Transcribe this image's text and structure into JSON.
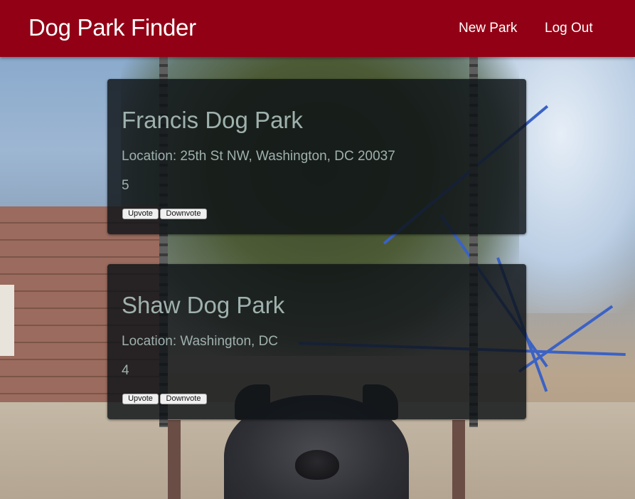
{
  "navbar": {
    "brand": "Dog Park Finder",
    "links": [
      {
        "label": "New Park"
      },
      {
        "label": "Log Out"
      }
    ],
    "color": "#920015"
  },
  "parks": [
    {
      "name": "Francis Dog Park",
      "location": "Location: 25th St NW, Washington, DC 20037",
      "votes": "5",
      "upvote_label": "Upvote",
      "downvote_label": "Downvote"
    },
    {
      "name": "Shaw Dog Park",
      "location": "Location: Washington, DC",
      "votes": "4",
      "upvote_label": "Upvote",
      "downvote_label": "Downvote"
    }
  ]
}
